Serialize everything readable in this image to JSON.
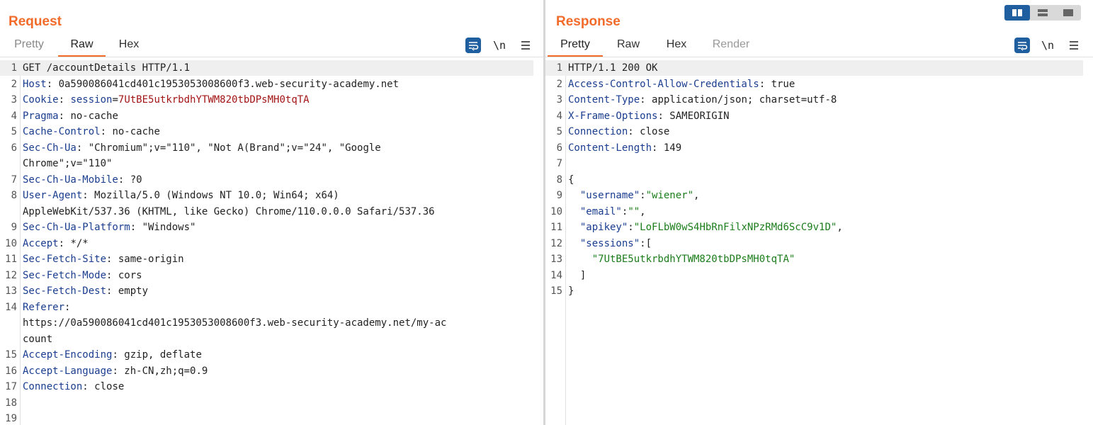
{
  "request": {
    "title": "Request",
    "tabs": [
      "Pretty",
      "Raw",
      "Hex"
    ],
    "active_tab": "Raw",
    "tool_newline": "\\n",
    "lines": [
      {
        "n": "1",
        "text": "GET /accountDetails HTTP/1.1"
      },
      {
        "n": "2",
        "key": "Host",
        "sep": ": ",
        "val": "0a590086041cd401c1953053008600f3.web-security-academy.net"
      },
      {
        "n": "3",
        "key": "Cookie",
        "sep": ": ",
        "ckey": "session",
        "ceq": "=",
        "val": "7UtBE5utkrbdhYTWM820tbDPsMH0tqTA"
      },
      {
        "n": "4",
        "key": "Pragma",
        "sep": ": ",
        "val": "no-cache"
      },
      {
        "n": "5",
        "key": "Cache-Control",
        "sep": ": ",
        "val": "no-cache"
      },
      {
        "n": "6",
        "key": "Sec-Ch-Ua",
        "sep": ": ",
        "val": "\"Chromium\";v=\"110\", \"Not A(Brand\";v=\"24\", \"Google"
      },
      {
        "n": "",
        "cont": "Chrome\";v=\"110\""
      },
      {
        "n": "7",
        "key": "Sec-Ch-Ua-Mobile",
        "sep": ": ",
        "val": "?0"
      },
      {
        "n": "8",
        "key": "User-Agent",
        "sep": ": ",
        "val": "Mozilla/5.0 (Windows NT 10.0; Win64; x64)"
      },
      {
        "n": "",
        "cont": "AppleWebKit/537.36 (KHTML, like Gecko) Chrome/110.0.0.0 Safari/537.36"
      },
      {
        "n": "9",
        "key": "Sec-Ch-Ua-Platform",
        "sep": ": ",
        "val": "\"Windows\""
      },
      {
        "n": "10",
        "key": "Accept",
        "sep": ": ",
        "val": "*/*"
      },
      {
        "n": "11",
        "key": "Sec-Fetch-Site",
        "sep": ": ",
        "val": "same-origin"
      },
      {
        "n": "12",
        "key": "Sec-Fetch-Mode",
        "sep": ": ",
        "val": "cors"
      },
      {
        "n": "13",
        "key": "Sec-Fetch-Dest",
        "sep": ": ",
        "val": "empty"
      },
      {
        "n": "14",
        "key": "Referer",
        "sep": ":",
        "val": ""
      },
      {
        "n": "",
        "cont": "https://0a590086041cd401c1953053008600f3.web-security-academy.net/my-ac"
      },
      {
        "n": "",
        "cont": "count"
      },
      {
        "n": "15",
        "key": "Accept-Encoding",
        "sep": ": ",
        "val": "gzip, deflate"
      },
      {
        "n": "16",
        "key": "Accept-Language",
        "sep": ": ",
        "val": "zh-CN,zh;q=0.9"
      },
      {
        "n": "17",
        "key": "Connection",
        "sep": ": ",
        "val": "close"
      },
      {
        "n": "18",
        "text": ""
      },
      {
        "n": "19",
        "text": ""
      }
    ]
  },
  "response": {
    "title": "Response",
    "tabs": [
      "Pretty",
      "Raw",
      "Hex",
      "Render"
    ],
    "active_tab": "Pretty",
    "tool_newline": "\\n",
    "lines": [
      {
        "n": "1",
        "text": "HTTP/1.1 200 OK"
      },
      {
        "n": "2",
        "key": "Access-Control-Allow-Credentials",
        "sep": ": ",
        "val": "true"
      },
      {
        "n": "3",
        "key": "Content-Type",
        "sep": ": ",
        "val": "application/json; charset=utf-8"
      },
      {
        "n": "4",
        "key": "X-Frame-Options",
        "sep": ": ",
        "val": "SAMEORIGIN"
      },
      {
        "n": "5",
        "key": "Connection",
        "sep": ": ",
        "val": "close"
      },
      {
        "n": "6",
        "key": "Content-Length",
        "sep": ": ",
        "val": "149"
      },
      {
        "n": "7",
        "text": ""
      },
      {
        "n": "8",
        "text": "{"
      },
      {
        "n": "9",
        "indent": "  ",
        "jkey": "\"username\"",
        "colon": ":",
        "jval": "\"wiener\"",
        "tail": ","
      },
      {
        "n": "10",
        "indent": "  ",
        "jkey": "\"email\"",
        "colon": ":",
        "jval": "\"\"",
        "tail": ","
      },
      {
        "n": "11",
        "indent": "  ",
        "jkey": "\"apikey\"",
        "colon": ":",
        "jval": "\"LoFLbW0wS4HbRnFilxNPzRMd6ScC9v1D\"",
        "tail": ","
      },
      {
        "n": "12",
        "indent": "  ",
        "jkey": "\"sessions\"",
        "colon": ":",
        "jval": "",
        "tail": "["
      },
      {
        "n": "13",
        "indent": "    ",
        "jkey": "",
        "colon": "",
        "jval": "\"7UtBE5utkrbdhYTWM820tbDPsMH0tqTA\"",
        "tail": ""
      },
      {
        "n": "14",
        "text": "  ]"
      },
      {
        "n": "15",
        "text": "}"
      }
    ]
  },
  "colors": {
    "accent": "#f26b2a",
    "tool_blue": "#1f5fa0",
    "header_key": "#1a3d8f",
    "cookie_value": "#a31515",
    "json_string": "#1b7d1b"
  },
  "icons": {
    "wrap": "word-wrap-icon",
    "menu": "hamburger-menu-icon",
    "layout": [
      "split-columns-icon",
      "split-rows-icon",
      "single-pane-icon"
    ]
  }
}
